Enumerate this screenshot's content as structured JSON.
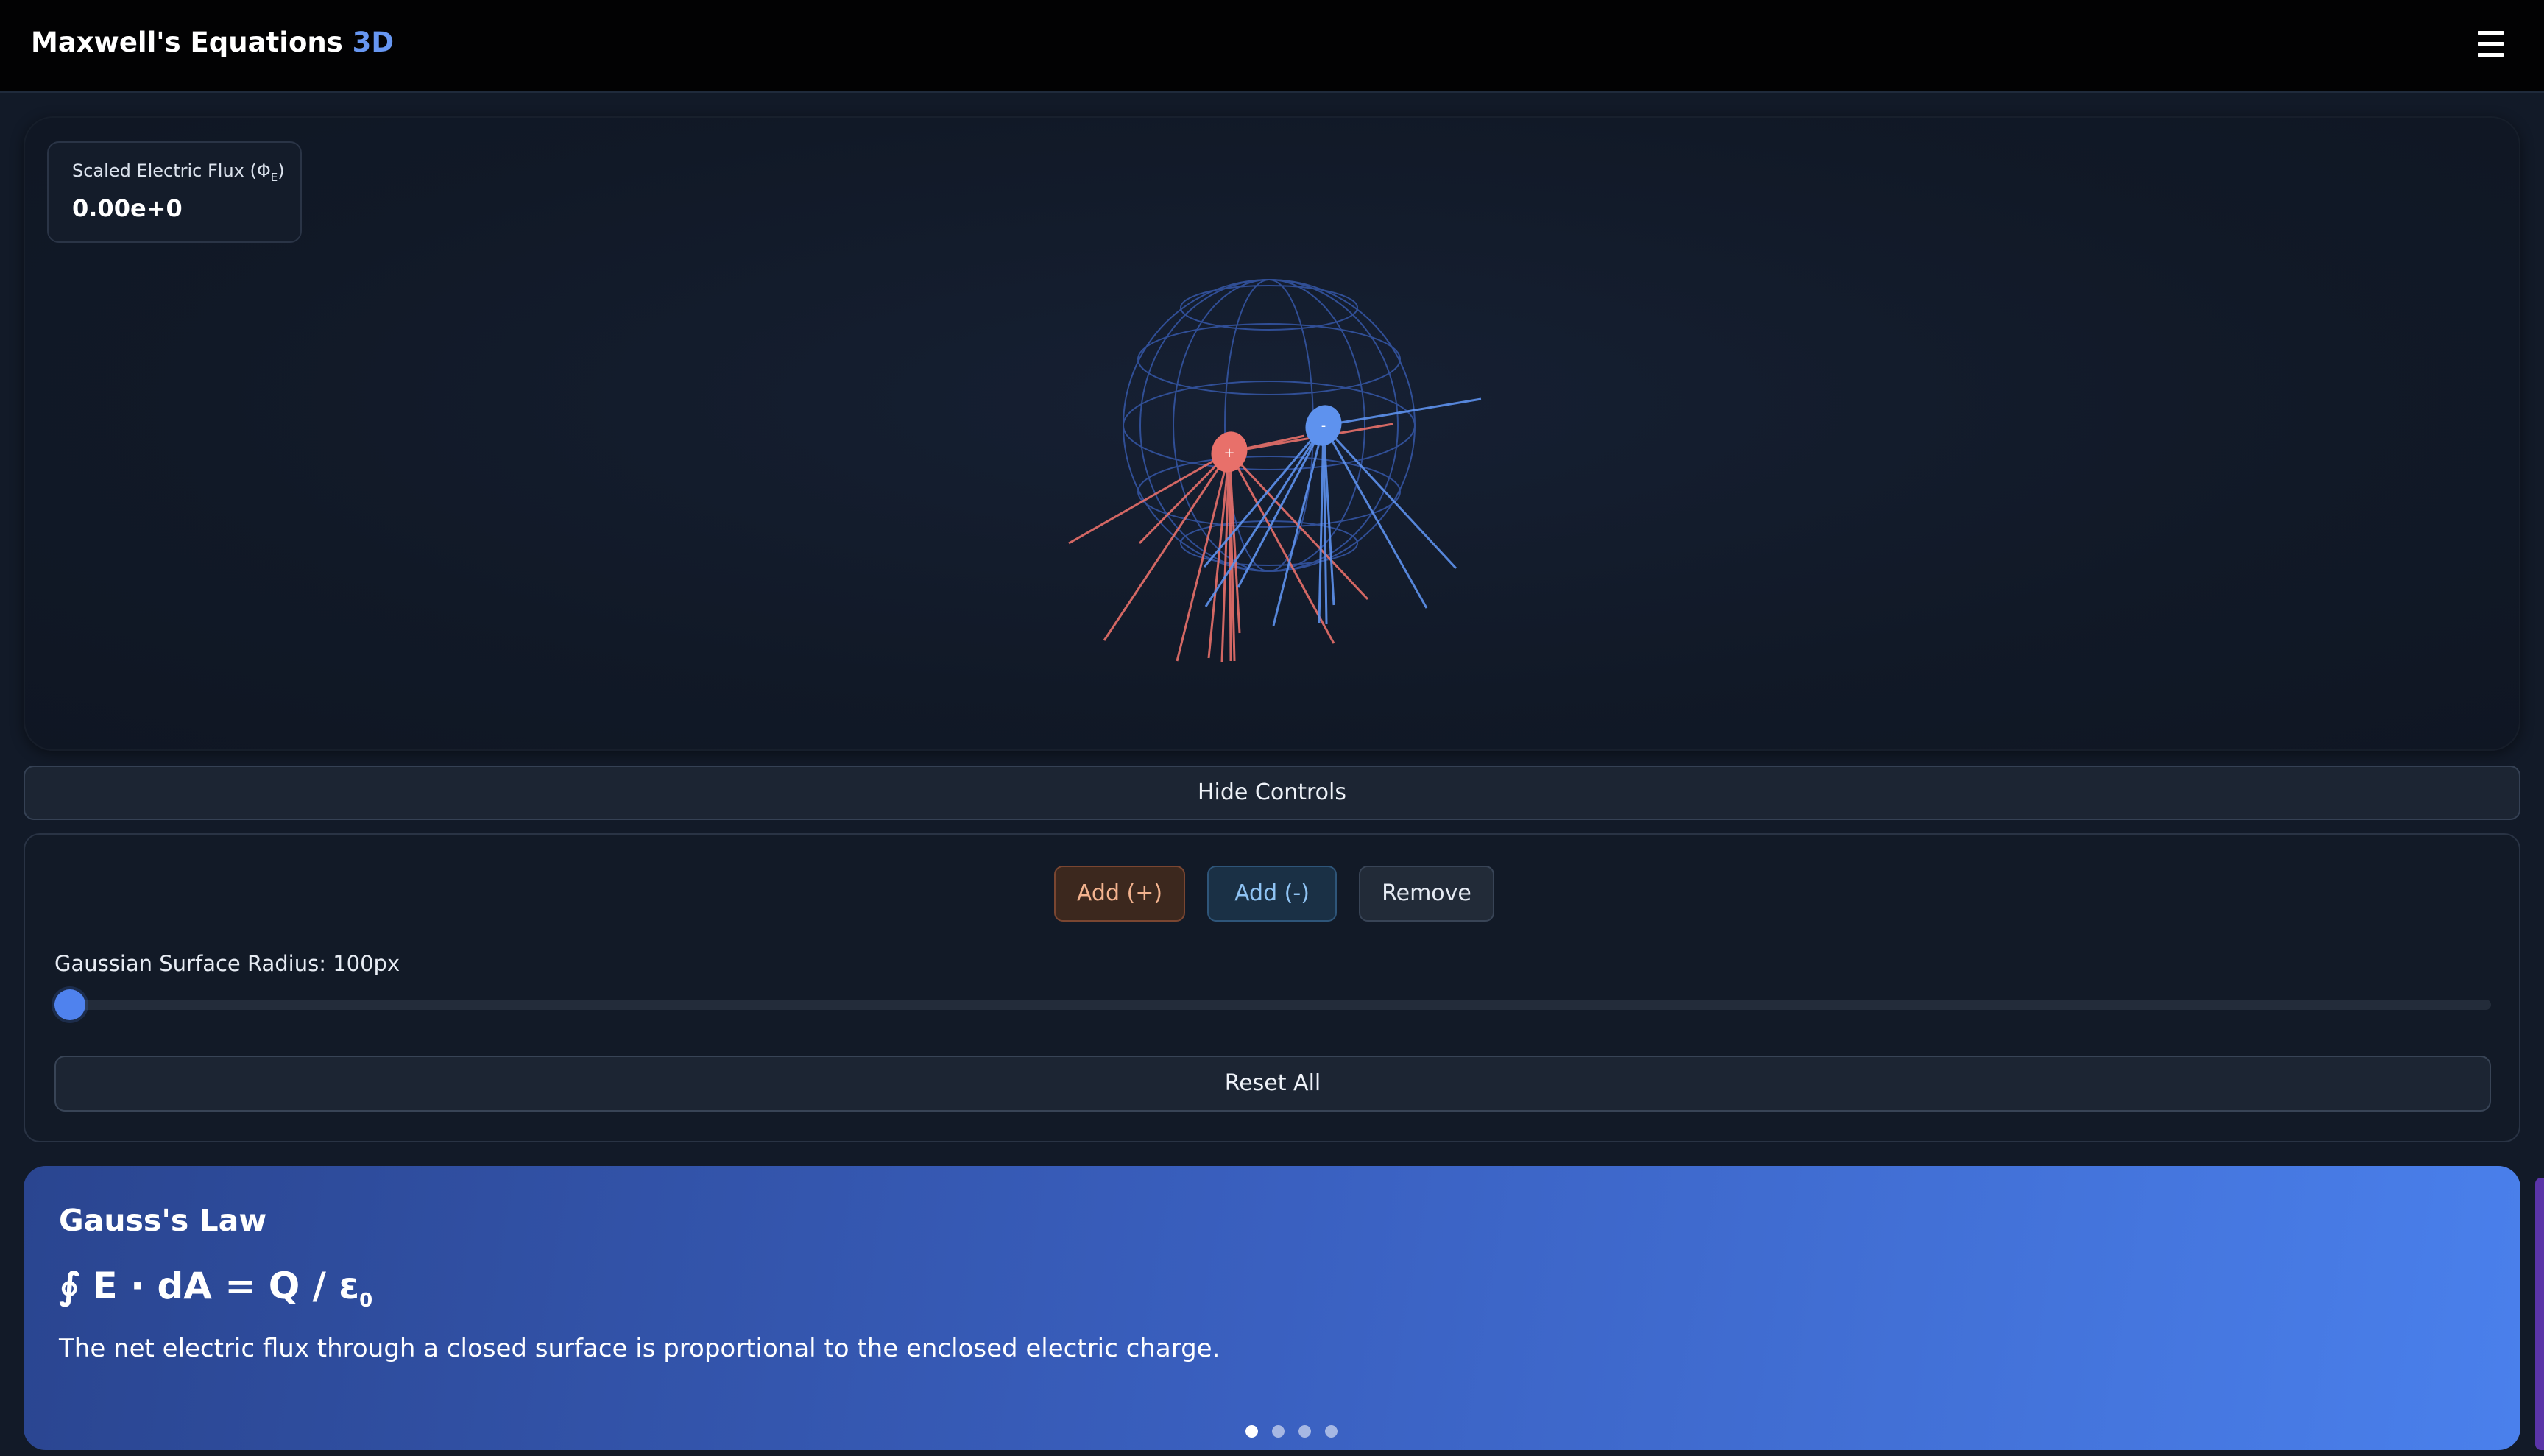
{
  "header": {
    "title": "Maxwell's Equations",
    "title_accent": "3D",
    "menu_icon": "hamburger-menu-icon"
  },
  "simulation": {
    "flux_label": "Scaled Electric Flux (Φ",
    "flux_label_sub": "E",
    "flux_label_end": ")",
    "flux_value": "0.00e+0",
    "charges": [
      {
        "sign": "+",
        "color": "#e8706a"
      },
      {
        "sign": "-",
        "color": "#5e92ee"
      }
    ],
    "gaussian_surface_color": "#3a5fb8"
  },
  "controls": {
    "toggle_label": "Hide Controls",
    "add_positive_label": "Add (+)",
    "add_negative_label": "Add (-)",
    "remove_label": "Remove",
    "radius_label": "Gaussian Surface Radius: 100px",
    "radius_fraction": 0.0,
    "reset_label": "Reset All"
  },
  "info_card": {
    "title": "Gauss's Law",
    "formula": "∮ E · dA = Q / ε",
    "formula_sub": "0",
    "description": "The net electric flux through a closed surface is proportional to the enclosed electric charge.",
    "slide_count": 4,
    "active_slide": 1
  },
  "colors": {
    "accent": "#6797f2",
    "positive": "#e8706a",
    "negative": "#5e92ee",
    "card_gradient_start": "#2a4590",
    "card_gradient_end": "#4a80ec"
  }
}
